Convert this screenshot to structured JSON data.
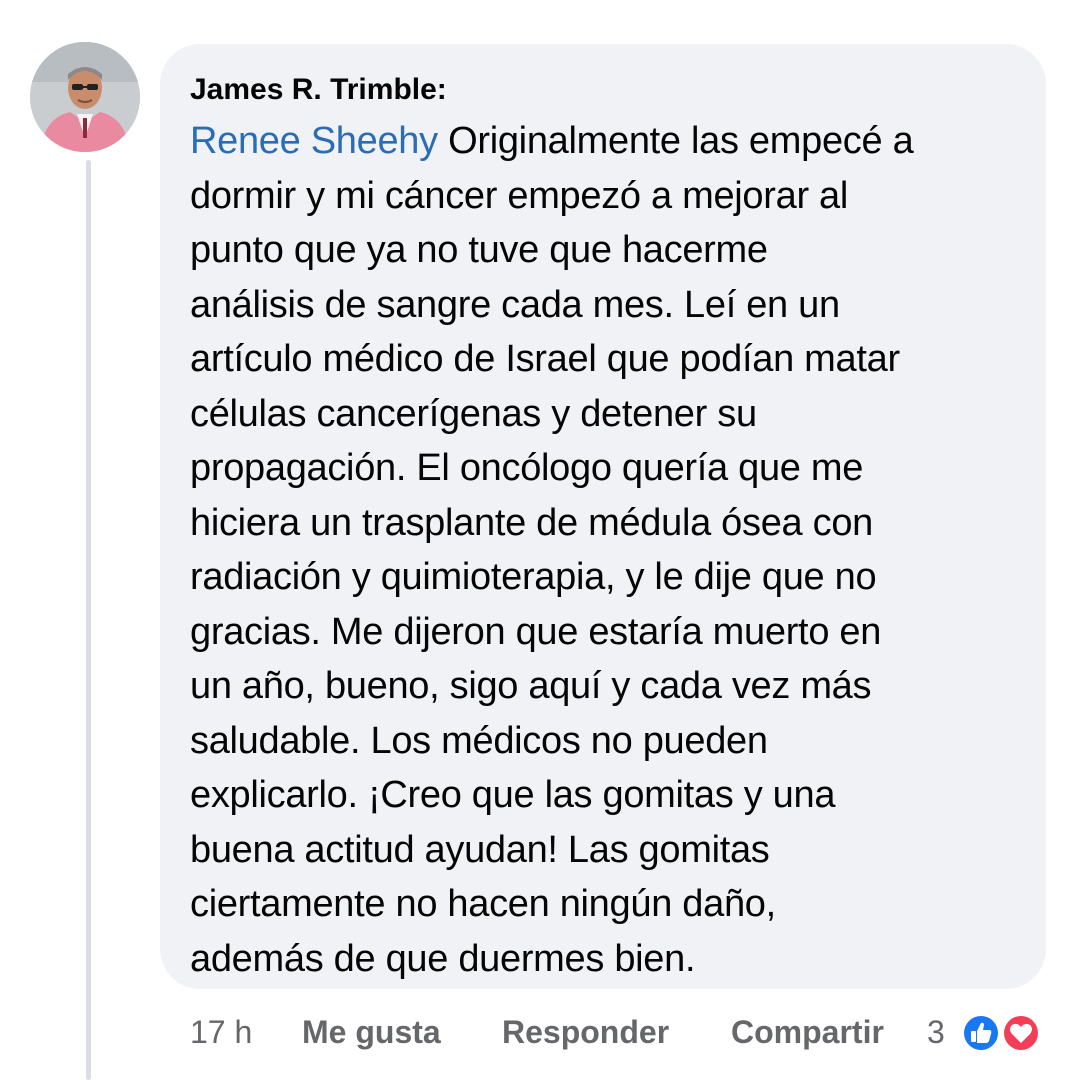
{
  "comment": {
    "author": "James R. Trimble:",
    "mention": "Renee Sheehy",
    "text_lines": [
      " Originalmente las empecé a",
      "dormir y mi cáncer empezó a mejorar al",
      "punto que ya no tuve que hacerme",
      "análisis de sangre cada mes. Leí en un",
      "artículo médico de Israel que podían matar",
      "células cancerígenas y detener su",
      "propagación. El oncólogo quería que me",
      "hiciera un trasplante de médula ósea con",
      "radiación y quimioterapia, y le dije que no",
      "gracias. Me dijeron que estaría muerto en",
      "un año, bueno, sigo aquí y cada vez más",
      "saludable. Los médicos no pueden",
      "explicarlo. ¡Creo que las gomitas y una",
      "buena actitud ayudan! Las gomitas",
      "ciertamente no hacen ningún daño,",
      "además de que duermes bien."
    ]
  },
  "actions": {
    "time": "17 h",
    "like": "Me gusta",
    "reply": "Responder",
    "share": "Compartir",
    "reaction_count": "3"
  },
  "reactions": [
    "like-icon",
    "love-icon"
  ],
  "colors": {
    "bubble": "#f0f2f5",
    "mention": "#2a6db5",
    "meta": "#65676b",
    "like": "#1877f2",
    "love": "#f33e58"
  }
}
